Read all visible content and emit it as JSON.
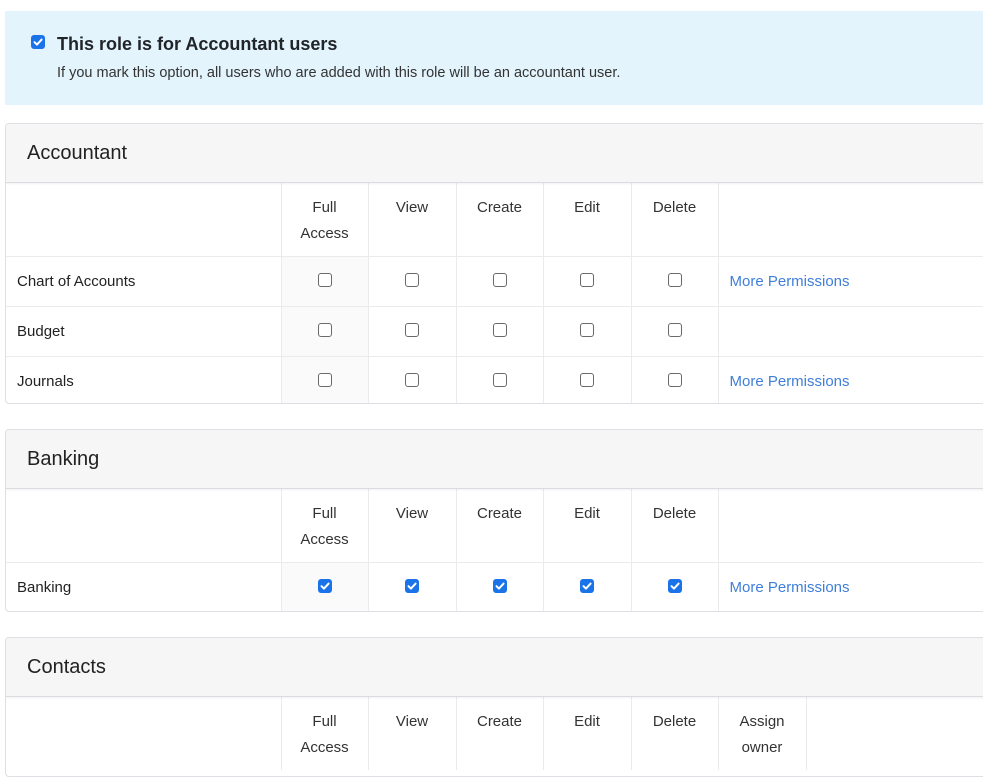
{
  "banner": {
    "checked": true,
    "title": "This role is for Accountant users",
    "description": "If you mark this option, all users who are added with this role will be an accountant user."
  },
  "accent_color": "#1a73e8",
  "link_color": "#3f7fd8",
  "sections": [
    {
      "title": "Accountant",
      "columns": [
        "Full Access",
        "View",
        "Create",
        "Edit",
        "Delete",
        ""
      ],
      "rows": [
        {
          "name": "Chart of Accounts",
          "full": false,
          "view": false,
          "create": false,
          "edit": false,
          "delete": false,
          "more": "More Permissions"
        },
        {
          "name": "Budget",
          "full": false,
          "view": false,
          "create": false,
          "edit": false,
          "delete": false,
          "more": ""
        },
        {
          "name": "Journals",
          "full": false,
          "view": false,
          "create": false,
          "edit": false,
          "delete": false,
          "more": "More Permissions"
        }
      ]
    },
    {
      "title": "Banking",
      "columns": [
        "Full Access",
        "View",
        "Create",
        "Edit",
        "Delete",
        ""
      ],
      "rows": [
        {
          "name": "Banking",
          "full": true,
          "view": true,
          "create": true,
          "edit": true,
          "delete": true,
          "more": "More Permissions"
        }
      ]
    },
    {
      "title": "Contacts",
      "columns": [
        "Full Access",
        "View",
        "Create",
        "Edit",
        "Delete",
        "Assign owner"
      ],
      "rows": []
    }
  ]
}
